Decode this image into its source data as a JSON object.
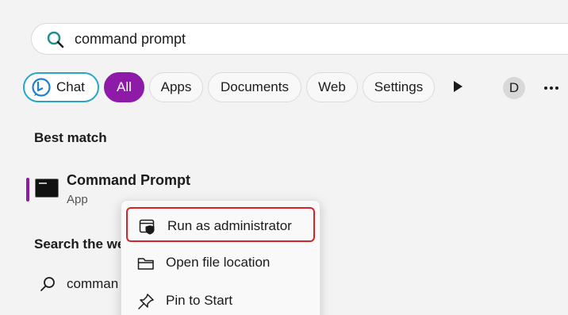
{
  "search": {
    "query": "command prompt",
    "icon": "search-icon"
  },
  "filters": {
    "chat": "Chat",
    "all": "All",
    "apps": "Apps",
    "documents": "Documents",
    "web": "Web",
    "settings": "Settings"
  },
  "account": {
    "initial": "D"
  },
  "colors": {
    "accent": "#8e1aa8",
    "chat_border": "#27a6c6",
    "highlight": "#d9232a"
  },
  "best_match": {
    "title": "Best match",
    "app_name": "Command Prompt",
    "app_type": "App"
  },
  "search_web": {
    "title": "Search the we",
    "query_partial": "comman"
  },
  "context_menu": {
    "items": [
      {
        "label": "Run as administrator",
        "icon": "shield-window-icon"
      },
      {
        "label": "Open file location",
        "icon": "folder-icon"
      },
      {
        "label": "Pin to Start",
        "icon": "pin-icon"
      }
    ]
  }
}
